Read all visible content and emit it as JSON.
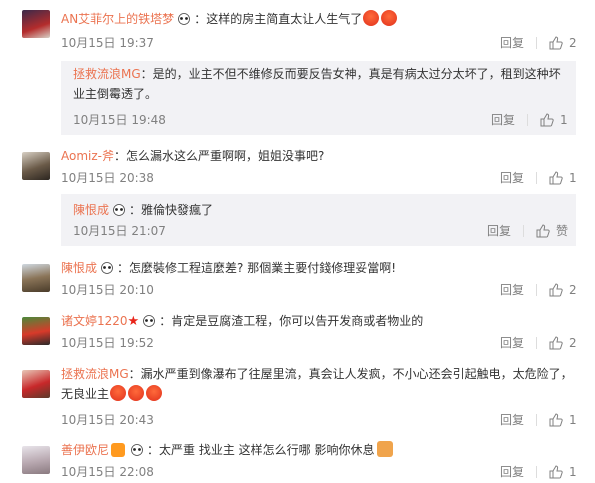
{
  "comments": [
    {
      "user": "AN艾菲尔上的铁塔梦",
      "text": "这样的房主简直太让人生气了",
      "time": "10月15日 19:37",
      "reply": "回复",
      "likes": "2",
      "sub": {
        "user": "拯救流浪MG",
        "text1": "是的，业主不但不维修反而要反告女神，真是有病太过分太坏了，租到这种坏",
        "text2": "业主倒霉透了。",
        "time": "10月15日 19:48",
        "reply": "回复",
        "likes": "1"
      }
    },
    {
      "user": "Aomiz-斧",
      "text": "怎么漏水这么严重啊啊，姐姐没事吧?",
      "time": "10月15日 20:38",
      "reply": "回复",
      "likes": "1",
      "sub": {
        "user": "陳恨成",
        "text": "雅倫快發瘋了",
        "time": "10月15日 21:07",
        "reply": "回复",
        "likes": "赞"
      }
    },
    {
      "user": "陳恨成",
      "text": "怎麼裝修工程這麼差? 那個業主要付錢修理妥當啊!",
      "time": "10月15日 20:10",
      "reply": "回复",
      "likes": "2"
    },
    {
      "user": "诸文婷1220",
      "text": "肯定是豆腐渣工程，你可以告开发商或者物业的",
      "time": "10月15日 19:52",
      "reply": "回复",
      "likes": "2"
    },
    {
      "user": "拯救流浪MG",
      "text1": "漏水严重到像瀑布了往屋里流，真会让人发疯，不小心还会引起触电，太危险了，",
      "text2": "无良业主",
      "time": "10月15日 20:43",
      "reply": "回复",
      "likes": "1"
    },
    {
      "user": "善伊欧尼",
      "text": "太严重   找业主   这样怎么行哪   影响你休息",
      "time": "10月15日 22:08",
      "reply": "回复",
      "likes": "1"
    }
  ],
  "colors": {
    "username": "#eb7350",
    "meta": "#808080",
    "reply_bg": "#f2f2f5"
  },
  "icons": [
    "thumbs-up-icon",
    "panda-icon",
    "angry-emoji-icon",
    "red-star-icon",
    "vip-badge-icon",
    "cat-emoji-icon"
  ]
}
